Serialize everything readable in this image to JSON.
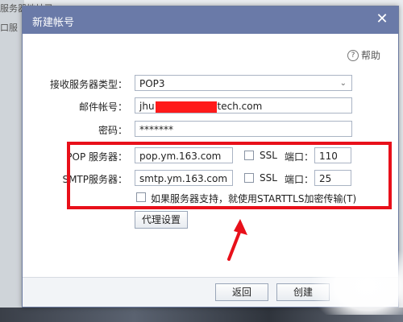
{
  "background": {
    "line1": "服务器地址已... ",
    "line2": "口服"
  },
  "dialog": {
    "title": "新建帐号",
    "help_label": "帮助",
    "fields": {
      "server_type_label": "接收服务器类型：",
      "server_type_value": "POP3",
      "email_label": "邮件帐号：",
      "email_prefix": "jhu",
      "email_suffix": "tech.com",
      "password_label": "密码：",
      "password_value": "*******"
    },
    "pop": {
      "label": "POP 服务器：",
      "server": "pop.ym.163.com",
      "ssl_label": "SSL",
      "port_label": "端口：",
      "port": "110"
    },
    "smtp": {
      "label": "SMTP服务器：",
      "server": "smtp.ym.163.com",
      "ssl_label": "SSL",
      "port_label": "端口：",
      "port": "25"
    },
    "starttls_label": "如果服务器支持，就使用STARTTLS加密传输(T)",
    "proxy_button": "代理设置",
    "back_button": "返回",
    "create_button": "创建"
  },
  "colors": {
    "titlebar": "#6a7aa8",
    "highlight": "#e8101a",
    "arrow": "#e8101a"
  }
}
